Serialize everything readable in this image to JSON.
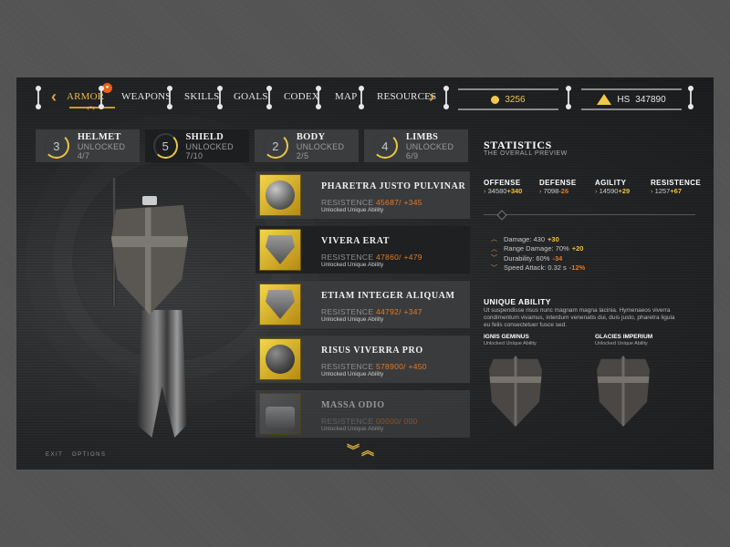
{
  "nav": {
    "items": [
      "ARMOR",
      "WEAPONS",
      "SKILLS",
      "GOALS",
      "CODEX",
      "MAP",
      "RESOURCES"
    ],
    "active": "ARMOR",
    "badge_icon": "eye-icon",
    "prev_icon": "chevron-left-icon",
    "next_icon": "chevron-right-icon",
    "currency": {
      "icon": "coin-icon",
      "value": "3256"
    },
    "highscore": {
      "icon": "triforce-icon",
      "label": "HS",
      "value": "347890"
    }
  },
  "categories": [
    {
      "number": "3",
      "title": "HELMET",
      "sub": "UNLOCKED 4/7",
      "progress": 0.57
    },
    {
      "number": "5",
      "title": "SHIELD",
      "sub": "UNLOCKED 7/10",
      "progress": 0.7
    },
    {
      "number": "2",
      "title": "BODY",
      "sub": "UNLOCKED 2/5",
      "progress": 0.4
    },
    {
      "number": "4",
      "title": "LIMBS",
      "sub": "UNLOCKED 6/9",
      "progress": 0.67
    }
  ],
  "items": [
    {
      "title": "PHARETRA JUSTO PULVINAR",
      "res_label": "RESISTENCE",
      "res_value": "45687/ +345",
      "sub": "Unlocked Unique Ability"
    },
    {
      "title": "VIVERA ERAT",
      "res_label": "RESISTENCE",
      "res_value": "47860/ +479",
      "sub": "Unlocked Unique Ability"
    },
    {
      "title": "ETIAM INTEGER ALIQUAM",
      "res_label": "RESISTENCE",
      "res_value": "44792/ +347",
      "sub": "Unlocked Unique Ability"
    },
    {
      "title": "RISUS VIVERRA PRO",
      "res_label": "RESISTENCE",
      "res_value": "578900/ +450",
      "sub": "Unlocked Unique Ability"
    },
    {
      "title": "MASSA ODIO",
      "res_label": "RESISTENCE",
      "res_value": "00000/ 000",
      "sub": "Unlocked Unique Ability"
    }
  ],
  "scroll": {
    "down_icon": "double-chevron-down-icon",
    "up_icon": "double-chevron-up-icon"
  },
  "statistics": {
    "title": "STATISTICS",
    "subtitle": "THE OVERALL PREVIEW",
    "stats": [
      {
        "name": "OFFENSE",
        "base": "34580",
        "delta": "+340",
        "dir": "pos"
      },
      {
        "name": "DEFENSE",
        "base": "7098",
        "delta": "-26",
        "dir": "neg"
      },
      {
        "name": "AGILITY",
        "base": "14590",
        "delta": "+29",
        "dir": "pos"
      },
      {
        "name": "RESISTENCE",
        "base": "1257",
        "delta": "+67",
        "dir": "pos"
      }
    ],
    "modifiers": [
      {
        "label": "Damage: 430",
        "delta": "+30",
        "dir": "pos"
      },
      {
        "label": "Range Damage: 70%",
        "delta": "+20",
        "dir": "pos"
      },
      {
        "label": "Durability: 60%",
        "delta": "-34",
        "dir": "neg"
      },
      {
        "label": "Speed Attack: 0.32 s",
        "delta": "-12%",
        "dir": "neg"
      }
    ]
  },
  "unique_ability": {
    "title": "UNIQUE ABILITY",
    "description": "Ut suspendisse risus nunc magnam magna lacinia. Hymenaeos viverra condimentum vivamus, interdum venenatis dui, duis justo, pharetra ligula eu felis consectetuer fusce sed.",
    "abilities": [
      {
        "name": "IGNIS GEMINUS",
        "sub": "Unlocked Unique Ability"
      },
      {
        "name": "GLACIES IMPERIUM",
        "sub": "Unlocked Unique Ability"
      }
    ]
  },
  "footer": {
    "exit": "EXIT",
    "options": "OPTIONS"
  }
}
